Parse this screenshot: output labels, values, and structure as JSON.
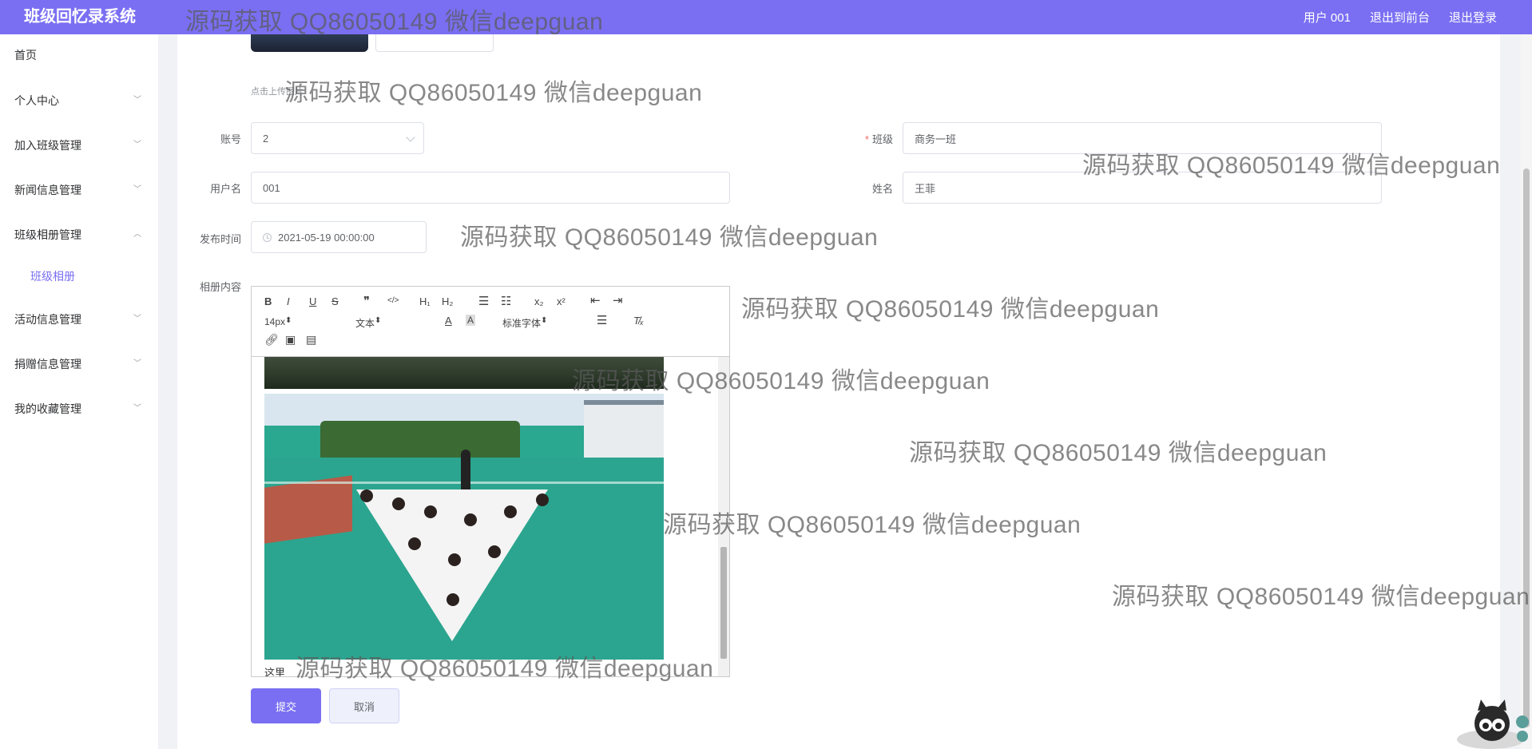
{
  "app": {
    "brand": "班级回忆录系统"
  },
  "header": {
    "user_label": "用户 001",
    "front_label": "退出到前台",
    "logout_label": "退出登录"
  },
  "sidebar": {
    "items": [
      {
        "label": "首页"
      },
      {
        "label": "个人中心"
      },
      {
        "label": "加入班级管理"
      },
      {
        "label": "新闻信息管理"
      },
      {
        "label": "班级相册管理"
      },
      {
        "label": "班级相册"
      },
      {
        "label": "活动信息管理"
      },
      {
        "label": "捐赠信息管理"
      },
      {
        "label": "我的收藏管理"
      }
    ]
  },
  "form": {
    "upload_tip": "点击上传图片",
    "account": {
      "label": "账号",
      "value": "2"
    },
    "class": {
      "label": "班级",
      "value": "商务一班"
    },
    "username": {
      "label": "用户名",
      "value": "001"
    },
    "name": {
      "label": "姓名",
      "value": "王菲"
    },
    "publish_time": {
      "label": "发布时间",
      "value": "2021-05-19 00:00:00"
    },
    "content": {
      "label": "相册内容",
      "text": "这里"
    }
  },
  "editor": {
    "font_size": "14px",
    "paragraph": "文本",
    "font_family": "标准字体",
    "tools": [
      "B",
      "I",
      "U",
      "S",
      "❞",
      "</>",
      "H₁",
      "H₂",
      "x₂",
      "x²",
      "A"
    ]
  },
  "buttons": {
    "submit": "提交",
    "cancel": "取消"
  },
  "watermark": "源码获取 QQ86050149 微信deepguan",
  "colors": {
    "accent": "#7a6ff2",
    "required": "#f56c6c"
  }
}
